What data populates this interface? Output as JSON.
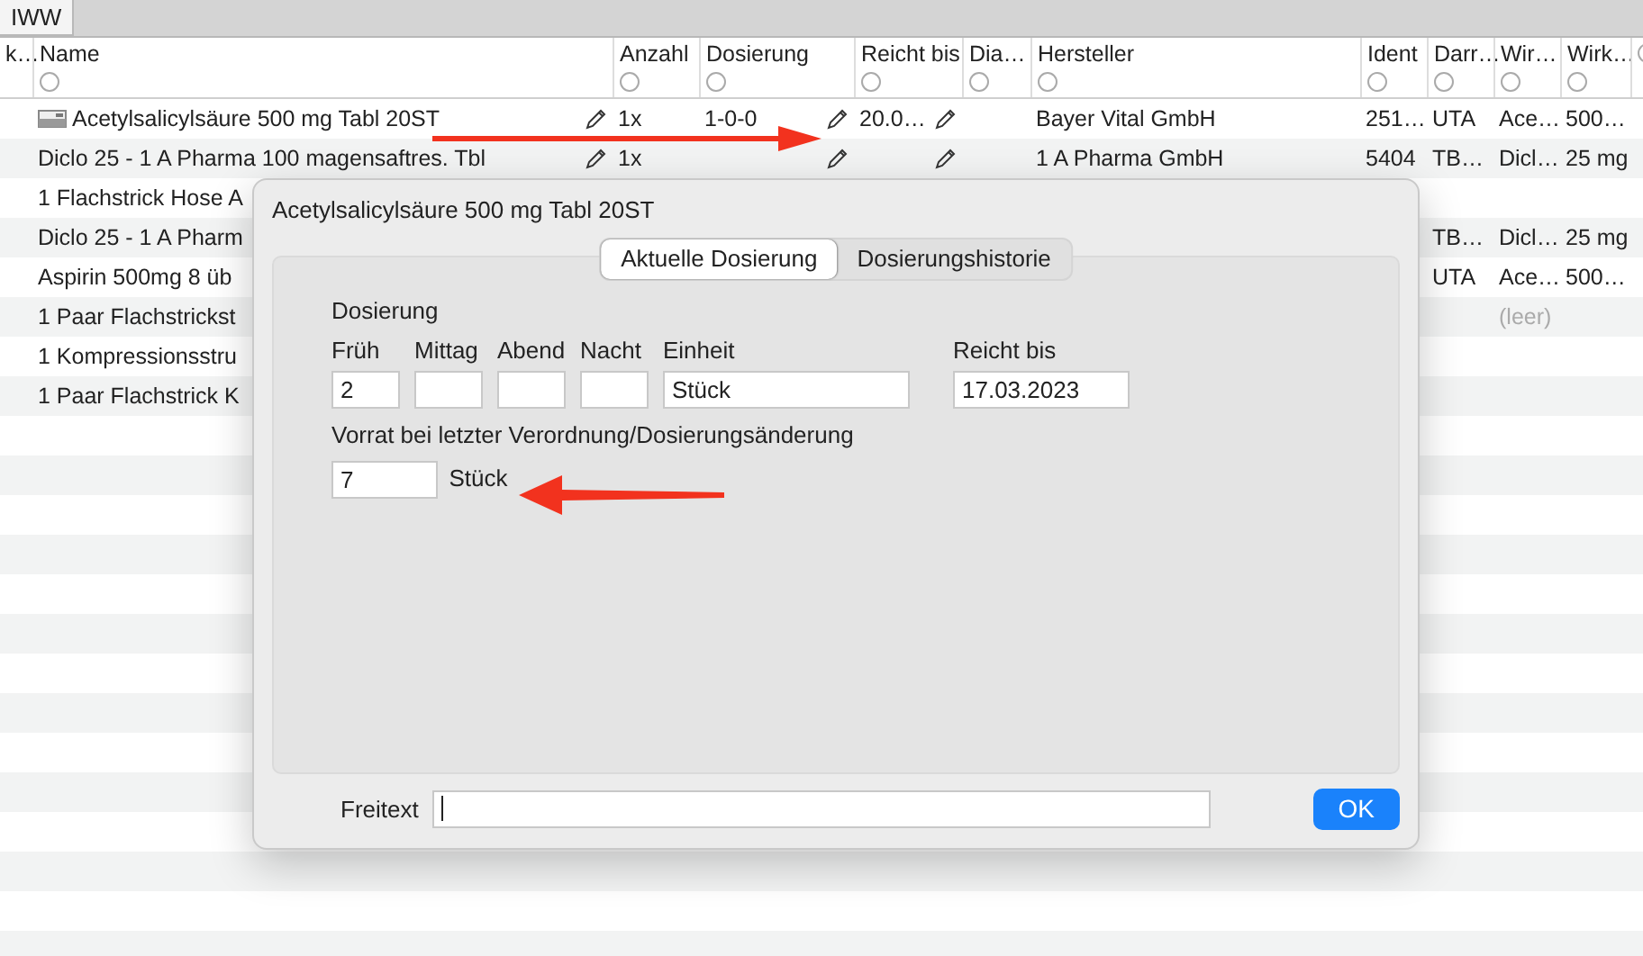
{
  "top_tabs": [
    {
      "label": "IWW"
    }
  ],
  "table": {
    "columns": [
      {
        "label": "k…",
        "filter": false
      },
      {
        "label": "Name",
        "filter": true
      },
      {
        "label": "Anzahl",
        "filter": true
      },
      {
        "label": "Dosierung",
        "filter": true
      },
      {
        "label": "Reicht bis",
        "filter": true
      },
      {
        "label": "Dia…",
        "filter": true
      },
      {
        "label": "Hersteller",
        "filter": true
      },
      {
        "label": "Ident",
        "filter": true
      },
      {
        "label": "Darr…",
        "filter": true
      },
      {
        "label": "Wir…",
        "filter": true
      },
      {
        "label": "Wirk…",
        "filter": true
      },
      {
        "filter": true
      }
    ],
    "rows": [
      {
        "kind": "tablet",
        "editable": true,
        "cells": {
          "name": "Acetylsalicylsäure 500 mg Tabl 20ST",
          "anzahl": "1x",
          "dosierung": "1-0-0",
          "reicht_bis": "20.0…",
          "hersteller": "Bayer Vital GmbH",
          "ident": "251…",
          "column_9": "UTA",
          "column_10": "Ace…",
          "column_11": "500…"
        }
      },
      {
        "editable": true,
        "cells": {
          "name": "Diclo 25 - 1 A Pharma 100 magensaftres. Tbl",
          "anzahl": "1x",
          "hersteller": "1 A Pharma GmbH",
          "ident": "5404",
          "column_9": "TB…",
          "column_10": "Dicl…",
          "column_11": "25 mg"
        }
      },
      {
        "cells": {
          "name": "1 Flachstrick Hose A"
        }
      },
      {
        "cells": {
          "name": "Diclo 25 - 1 A Pharm",
          "column_9": "TB…",
          "column_10": "Dicl…",
          "column_11": "25 mg"
        }
      },
      {
        "cells": {
          "name": "Aspirin 500mg 8 üb",
          "column_9": "UTA",
          "column_10": "Ace…",
          "column_11": "500…"
        }
      },
      {
        "cells": {
          "name": "1 Paar Flachstrickst"
        },
        "placeholders": {
          "column_10": "(leer)"
        }
      },
      {
        "cells": {
          "name": "1 Kompressionsstru"
        }
      },
      {
        "cells": {
          "name": "1 Paar Flachstrick K"
        }
      }
    ]
  },
  "popover": {
    "title": "Acetylsalicylsäure 500 mg Tabl 20ST",
    "tabs": [
      {
        "label": "Aktuelle Dosierung",
        "selected": true
      },
      {
        "label": "Dosierungshistorie",
        "selected": false
      }
    ],
    "group_label": "Dosierung",
    "dose_fields": [
      {
        "label": "Früh",
        "value": "2"
      },
      {
        "label": "Mittag"
      },
      {
        "label": "Abend"
      },
      {
        "label": "Nacht"
      }
    ],
    "unit_field": {
      "label": "Einheit",
      "value": "Stück"
    },
    "until_field": {
      "label": "Reicht bis",
      "value": "17.03.2023"
    },
    "stock": {
      "label": "Vorrat bei letzter Verordnung/Dosierungsänderung",
      "value": "7",
      "unit": "Stück"
    },
    "freetext": {
      "label": "Freitext",
      "focused": true
    },
    "ok_button": "OK"
  },
  "annotations": [
    {
      "kind": "rightarrow"
    },
    {
      "kind": "leftarrow"
    }
  ]
}
